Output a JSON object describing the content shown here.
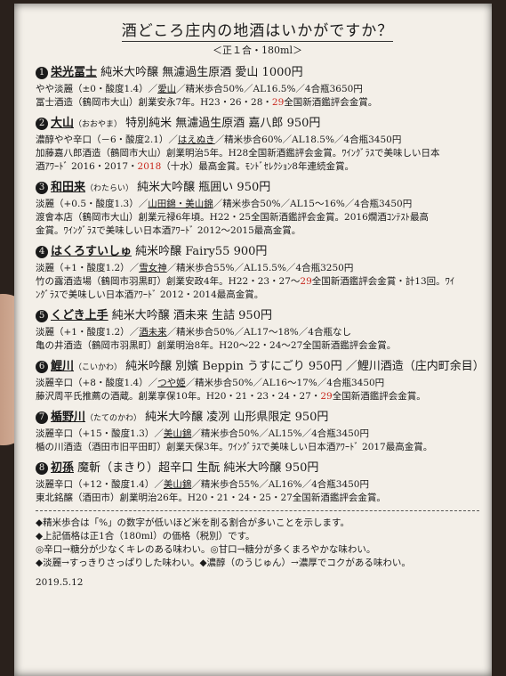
{
  "title": "酒どころ庄内の地酒はいかがですか？",
  "subtitle": "＜正１合・180ml＞",
  "entries": [
    {
      "num": "1",
      "name": "栄光冨士",
      "reading": "",
      "desc": "純米大吟醸 無濾過生原酒 愛山 1000円",
      "l1a": "やや淡麗（±0・酸度1.4）／",
      "l1b": "愛山",
      "l1c": "／精米歩合50%／AL16.5%／4合瓶3650円",
      "l2a": "冨士酒造（鶴岡市大山）創業安永7年。H23・26・28・",
      "l2b": "29",
      "l2c": "全国新酒鑑評会金賞。",
      "l3": ""
    },
    {
      "num": "2",
      "name": "大山",
      "reading": "（おおやま）",
      "desc": "特別純米 無濾過生原酒 嘉八郎 950円",
      "l1a": "濃醇やや辛口（－6・酸度2.1）／",
      "l1b": "はえぬき",
      "l1c": "／精米歩合60%／AL18.5%／4合瓶3450円",
      "l2a": "加藤嘉八郎酒造（鶴岡市大山）創業明治5年。H28全国新酒鑑評会金賞。ﾜｲﾝｸﾞﾗｽで美味しい日本",
      "l2b": "",
      "l2c": "",
      "l3a": "酒ｱﾜｰﾄﾞ 2016・2017・",
      "l3b": "2018",
      "l3c": "（十水）最高金賞。ﾓﾝﾄﾞｾﾚｸｼｮﾝ8年連続金賞。"
    },
    {
      "num": "3",
      "name": "和田来",
      "reading": "（わたらい）",
      "desc": "純米大吟醸 瓶囲い 950円",
      "l1a": "淡麗（+0.5・酸度1.3）／",
      "l1b": "山田錦・美山錦",
      "l1c": "／精米歩合50%／AL15～16%／4合瓶3450円",
      "l2a": "渡會本店（鶴岡市大山）創業元禄6年頃。H22・25全国新酒鑑評会金賞。2016燗酒ｺﾝﾃｽﾄ最高",
      "l2b": "",
      "l2c": "",
      "l3a": "金賞。ﾜｲﾝｸﾞﾗｽで美味しい日本酒ｱﾜｰﾄﾞ 2012～2015最高金賞。",
      "l3b": "",
      "l3c": ""
    },
    {
      "num": "4",
      "name": "はくろすいしゅ",
      "reading": "",
      "desc": "純米吟醸 Fairy55 900円",
      "l1a": "淡麗（+1・酸度1.2）／",
      "l1b": "雪女神",
      "l1c": "／精米歩合55%／AL15.5%／4合瓶3250円",
      "l2a": "竹の露酒造場（鶴岡市羽黒町）創業安政4年。H22・23・27～",
      "l2b": "29",
      "l2c": "全国新酒鑑評会金賞・計13回。ﾜｲ",
      "l3a": "ﾝｸﾞﾗｽで美味しい日本酒ｱﾜｰﾄﾞ 2012・2014最高金賞。",
      "l3b": "",
      "l3c": ""
    },
    {
      "num": "5",
      "name": "くどき上手",
      "reading": "",
      "desc": "純米大吟醸 酒未来 生詰 950円",
      "l1a": "淡麗（+1・酸度1.2）／",
      "l1b": "酒未来",
      "l1c": "／精米歩合50%／AL17～18%／4合瓶なし",
      "l2a": "亀の井酒造（鶴岡市羽黒町）創業明治8年。H20～22・24～27全国新酒鑑評会金賞。",
      "l2b": "",
      "l2c": "",
      "l3a": "",
      "l3b": "",
      "l3c": ""
    },
    {
      "num": "6",
      "name": "鯉川",
      "reading": "（こいかわ）",
      "desc": "純米吟醸 別嬪 Beppin うすにごり 950円 ／鯉川酒造（庄内町余目）",
      "l1a": "淡麗辛口（+8・酸度1.4）／",
      "l1b": "つや姫",
      "l1c": "／精米歩合50%／AL16～17%／4合瓶3450円",
      "l2a": "藤沢周平氏推薦の酒蔵。創業享保10年。H20・21・23・24・27・",
      "l2b": "29",
      "l2c": "全国新酒鑑評会金賞。",
      "l3a": "",
      "l3b": "",
      "l3c": ""
    },
    {
      "num": "7",
      "name": "楯野川",
      "reading": "（たてのかわ）",
      "desc": "純米大吟醸 凌冽 山形県限定 950円",
      "l1a": "淡麗辛口（+15・酸度1.3）／",
      "l1b": "美山錦",
      "l1c": "／精米歩合50%／AL15%／4合瓶3450円",
      "l2a": "楯の川酒造（酒田市旧平田町）創業天保3年。ﾜｲﾝｸﾞﾗｽで美味しい日本酒ｱﾜｰﾄﾞ 2017最高金賞。",
      "l2b": "",
      "l2c": "",
      "l3a": "",
      "l3b": "",
      "l3c": ""
    },
    {
      "num": "8",
      "name": "初孫",
      "reading": "",
      "desc": "魔斬（まきり）超辛口 生酛 純米大吟醸 950円",
      "l1a": "淡麗辛口（+12・酸度1.4）／",
      "l1b": "美山錦",
      "l1c": "／精米歩合55%／AL16%／4合瓶3450円",
      "l2a": "東北銘醸（酒田市）創業明治26年。H20・21・24・25・27全国新酒鑑評会金賞。",
      "l2b": "",
      "l2c": "",
      "l3a": "",
      "l3b": "",
      "l3c": ""
    }
  ],
  "notes": [
    "◆精米歩合は「%」の数字が低いほど米を削る割合が多いことを示します。",
    "◆上記価格は正1合（180ml）の価格（税別）です。",
    "◎辛口→糖分が少なくキレのある味わい。◎甘口→糖分が多くまろやかな味わい。",
    "◆淡麗→すっきりさっぱりした味わい。◆濃醇（のうじゅん）→濃厚でコクがある味わい。"
  ],
  "date": "2019.5.12"
}
